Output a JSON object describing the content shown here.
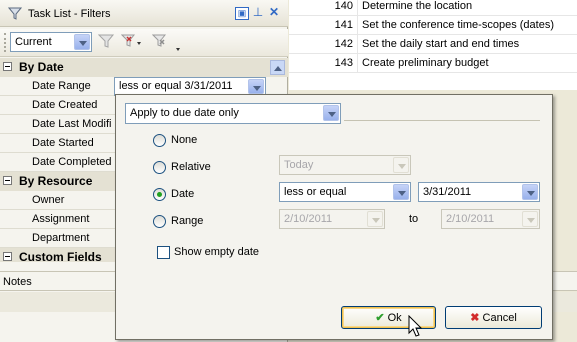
{
  "panel": {
    "title": "Task List - Filters",
    "view_select": "Current",
    "groups": [
      {
        "label": "By Date",
        "items": [
          "Date Range",
          "Date Created",
          "Date Last Modifi",
          "Date Started",
          "Date Completed"
        ]
      },
      {
        "label": "By Resource",
        "items": [
          "Owner",
          "Assignment",
          "Department"
        ]
      },
      {
        "label": "Custom Fields",
        "items": []
      }
    ],
    "date_range_value": "less or equal 3/31/2011"
  },
  "tasks": [
    {
      "num": "140",
      "name": "Determine the location"
    },
    {
      "num": "141",
      "name": "Set the conference time-scopes (dates)"
    },
    {
      "num": "142",
      "name": "Set the daily start and end times"
    },
    {
      "num": "143",
      "name": "Create preliminary budget"
    }
  ],
  "notes_label": "Notes",
  "popup": {
    "apply_select": "Apply to due date only",
    "options": {
      "none": "None",
      "relative": "Relative",
      "date": "Date",
      "range": "Range"
    },
    "selected": "Date",
    "relative_value": "Today",
    "date_operator": "less or equal",
    "date_value": "3/31/2011",
    "range_from": "2/10/2011",
    "range_to_label": "to",
    "range_to": "2/10/2011",
    "show_empty_label": "Show empty date",
    "ok_label": "Ok",
    "cancel_label": "Cancel"
  },
  "colors": {
    "ok_icon": "#2e9e2e",
    "cancel_icon": "#d22b2b",
    "accent": "#316ac5"
  }
}
